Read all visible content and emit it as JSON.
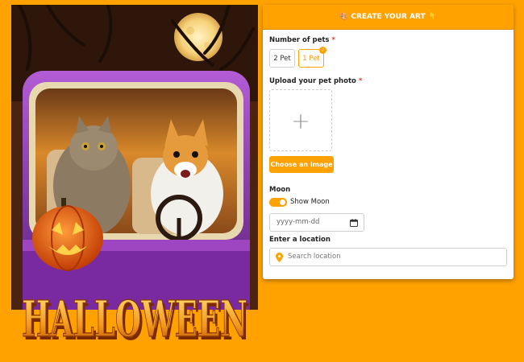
{
  "artwork": {
    "title_text": "HALLOWEEN"
  },
  "form": {
    "header": {
      "left_emoji": "🎨",
      "title": "CREATE YOUR ART",
      "right_emoji": "👇"
    },
    "pets": {
      "label": "Number of pets",
      "required_mark": "*",
      "options": [
        {
          "label": "2 Pet",
          "selected": false
        },
        {
          "label": "1 Pet",
          "selected": true
        }
      ],
      "selected_mark": "✓"
    },
    "upload": {
      "label": "Upload your pet photo",
      "required_mark": "*",
      "plus_glyph": "+",
      "button_label": "Choose an image"
    },
    "moon": {
      "label": "Moon",
      "toggle_label": "Show Moon",
      "toggle_on": true,
      "date_placeholder": "yyyy-mm-dd"
    },
    "location": {
      "label": "Enter a location",
      "placeholder": "Search location"
    }
  },
  "colors": {
    "accent": "#ffa200",
    "required": "#e53935"
  }
}
